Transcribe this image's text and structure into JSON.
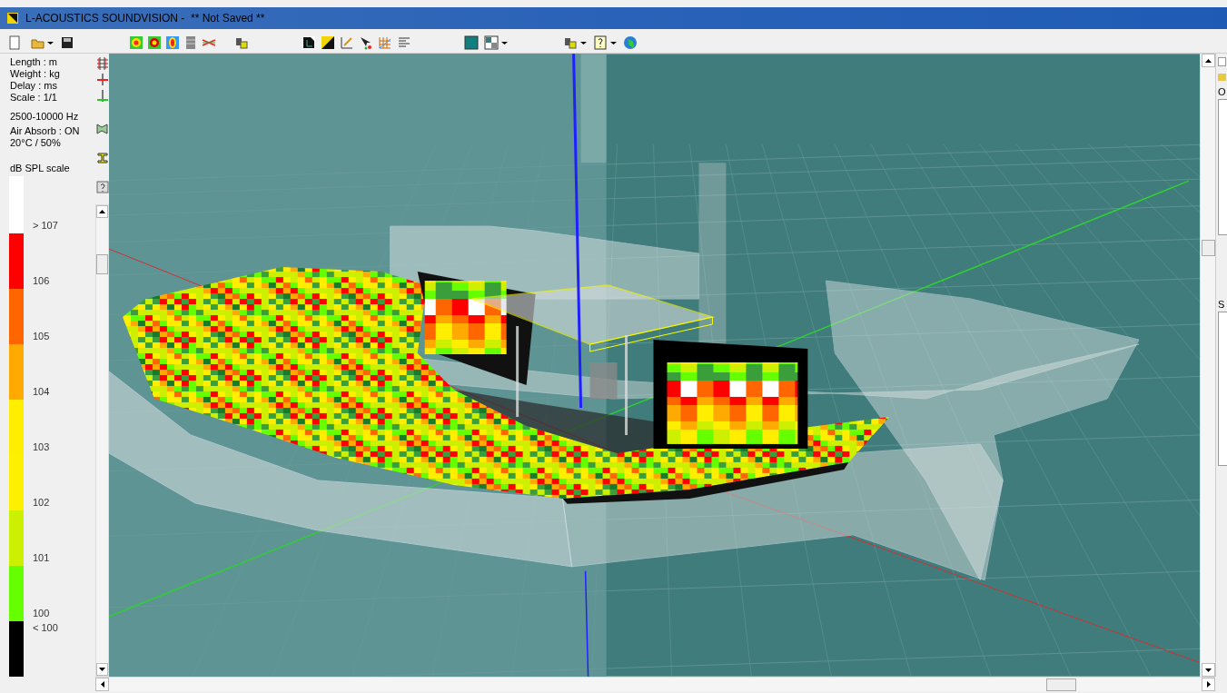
{
  "window": {
    "title": "L-ACOUSTICS SOUNDVISION -  ** Not Saved **"
  },
  "info": {
    "units": [
      "Length : m",
      "Weight : kg",
      "Delay : ms",
      "Scale : 1/1"
    ],
    "settings": [
      "2500-10000 Hz",
      "Air Absorb : ON",
      "20°C / 50%"
    ]
  },
  "scale": {
    "title": "dB SPL scale",
    "bands": [
      {
        "color": "#ffffff",
        "label": "> 107"
      },
      {
        "color": "#ff0000",
        "label": "106"
      },
      {
        "color": "#ff6600",
        "label": "105"
      },
      {
        "color": "#ffaa00",
        "label": "104"
      },
      {
        "color": "#ffee00",
        "label": "103"
      },
      {
        "color": "#fff000",
        "label": "102"
      },
      {
        "color": "#ccf000",
        "label": "101"
      },
      {
        "color": "#66ff00",
        "label": "100"
      },
      {
        "color": "#000000",
        "label": "< 100"
      }
    ]
  },
  "right_panel": {
    "labels": [
      "O",
      "S"
    ]
  }
}
